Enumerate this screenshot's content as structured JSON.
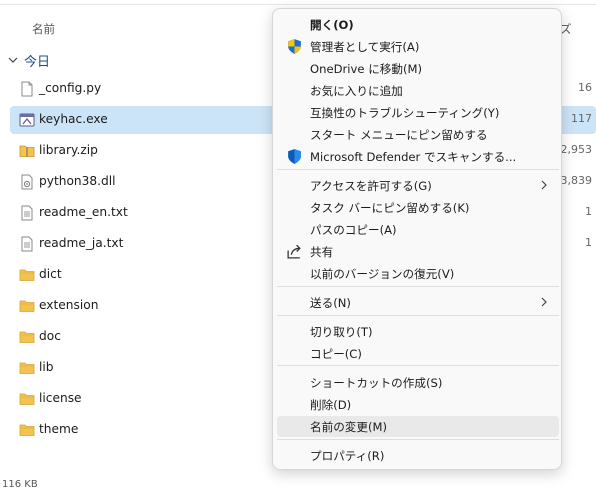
{
  "header": {
    "name_col": "名前",
    "size_col_fragment": "ズ"
  },
  "group": {
    "label": "今日"
  },
  "files": [
    {
      "name": "_config.py",
      "size": "16",
      "icon": "python-file-icon"
    },
    {
      "name": "keyhac.exe",
      "size": "117",
      "icon": "exe-icon",
      "selected": true
    },
    {
      "name": "library.zip",
      "size": "2,953",
      "icon": "zip-folder-icon"
    },
    {
      "name": "python38.dll",
      "size": "3,839",
      "icon": "dll-file-icon"
    },
    {
      "name": "readme_en.txt",
      "size": "1",
      "icon": "text-file-icon"
    },
    {
      "name": "readme_ja.txt",
      "size": "1",
      "icon": "text-file-icon"
    },
    {
      "name": "dict",
      "size": "",
      "icon": "folder-icon"
    },
    {
      "name": "extension",
      "size": "",
      "icon": "folder-icon"
    },
    {
      "name": "doc",
      "size": "",
      "icon": "folder-icon"
    },
    {
      "name": "lib",
      "size": "",
      "icon": "folder-icon"
    },
    {
      "name": "license",
      "size": "",
      "icon": "folder-icon"
    },
    {
      "name": "theme",
      "size": "",
      "icon": "folder-icon"
    }
  ],
  "status": {
    "items": "",
    "selection": "116 KB"
  },
  "menu": {
    "items": [
      {
        "label": "開く(O)",
        "bold": true,
        "icon": ""
      },
      {
        "label": "管理者として実行(A)",
        "icon": "uac-shield-icon"
      },
      {
        "label": "OneDrive に移動(M)",
        "icon": ""
      },
      {
        "label": "お気に入りに追加",
        "icon": ""
      },
      {
        "label": "互換性のトラブルシューティング(Y)",
        "icon": ""
      },
      {
        "label": "スタート メニューにピン留めする",
        "icon": ""
      },
      {
        "label": "Microsoft Defender でスキャンする...",
        "icon": "defender-shield-icon"
      },
      {
        "label": "アクセスを許可する(G)",
        "icon": "",
        "submenu": true
      },
      {
        "label": "タスク バーにピン留めする(K)",
        "icon": ""
      },
      {
        "label": "パスのコピー(A)",
        "icon": ""
      },
      {
        "label": "共有",
        "icon": "share-icon"
      },
      {
        "label": "以前のバージョンの復元(V)",
        "icon": ""
      },
      {
        "label": "送る(N)",
        "icon": "",
        "submenu": true
      },
      {
        "label": "切り取り(T)",
        "icon": ""
      },
      {
        "label": "コピー(C)",
        "icon": ""
      },
      {
        "label": "ショートカットの作成(S)",
        "icon": ""
      },
      {
        "label": "削除(D)",
        "icon": ""
      },
      {
        "label": "名前の変更(M)",
        "icon": "",
        "hover": true
      },
      {
        "label": "プロパティ(R)",
        "icon": ""
      }
    ]
  },
  "colors": {
    "selection": "#cce4f7",
    "menu_bg": "#f9f9f9",
    "folder": "#f3c24f",
    "accent": "#0067c0"
  }
}
